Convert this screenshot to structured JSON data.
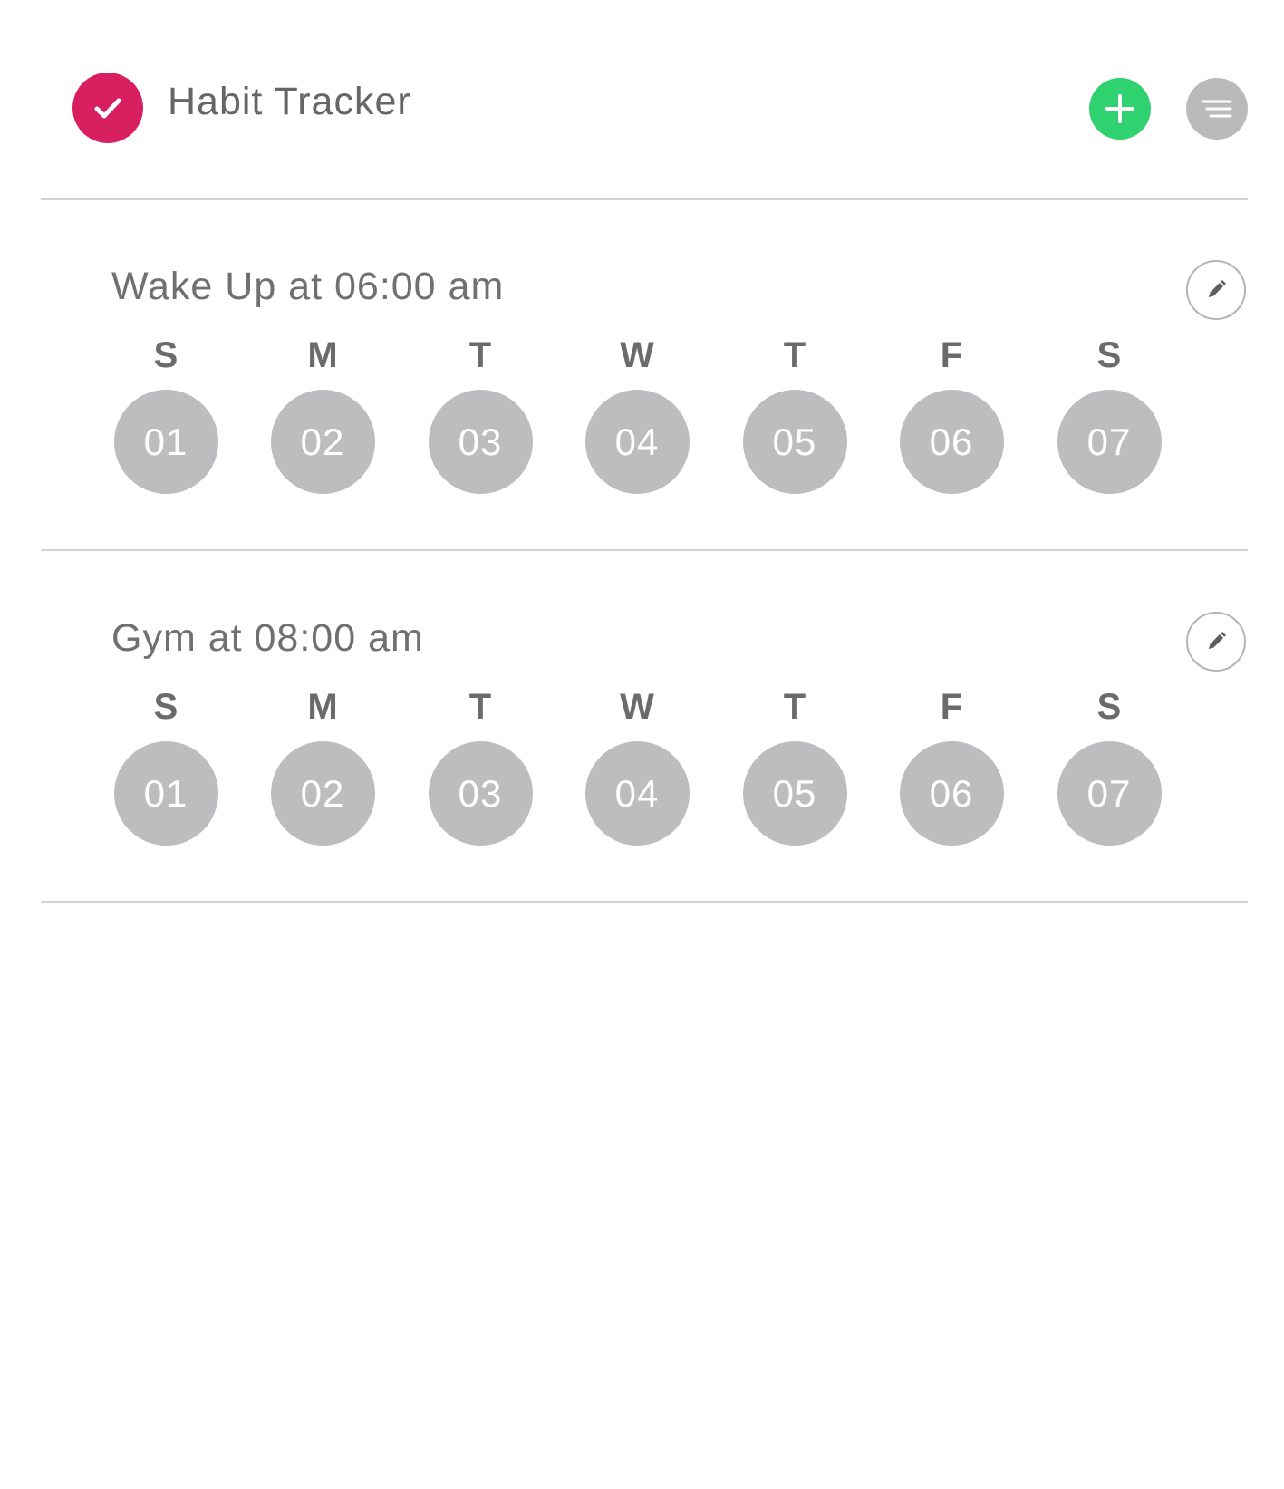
{
  "header": {
    "app_title": "Habit Tracker",
    "logo_icon": "checkmark-icon",
    "add_icon": "plus-icon",
    "menu_icon": "menu-icon"
  },
  "colors": {
    "brand": "#d81f5f",
    "add": "#2fd26f",
    "neutral": "#bdbdbf",
    "text": "#6b6b6e"
  },
  "habits": [
    {
      "title": "Wake Up at 06:00 am",
      "days": [
        {
          "letter": "S",
          "date": "01"
        },
        {
          "letter": "M",
          "date": "02"
        },
        {
          "letter": "T",
          "date": "03"
        },
        {
          "letter": "W",
          "date": "04"
        },
        {
          "letter": "T",
          "date": "05"
        },
        {
          "letter": "F",
          "date": "06"
        },
        {
          "letter": "S",
          "date": "07"
        }
      ]
    },
    {
      "title": "Gym at 08:00 am",
      "days": [
        {
          "letter": "S",
          "date": "01"
        },
        {
          "letter": "M",
          "date": "02"
        },
        {
          "letter": "T",
          "date": "03"
        },
        {
          "letter": "W",
          "date": "04"
        },
        {
          "letter": "T",
          "date": "05"
        },
        {
          "letter": "F",
          "date": "06"
        },
        {
          "letter": "S",
          "date": "07"
        }
      ]
    }
  ]
}
